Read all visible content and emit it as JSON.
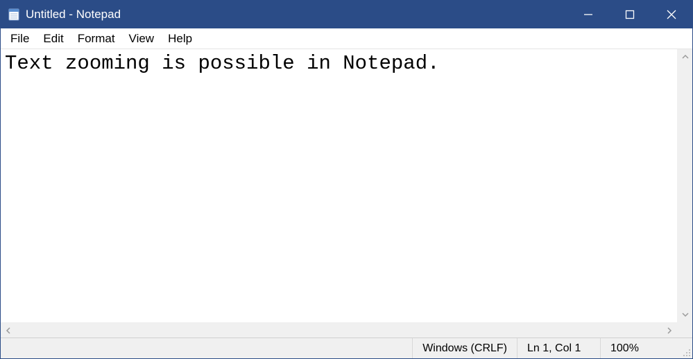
{
  "titlebar": {
    "title": "Untitled - Notepad"
  },
  "menu": {
    "items": [
      "File",
      "Edit",
      "Format",
      "View",
      "Help"
    ]
  },
  "editor": {
    "content": "Text zooming is possible in Notepad."
  },
  "statusbar": {
    "line_ending": "Windows (CRLF)",
    "cursor": "Ln 1, Col 1",
    "zoom": "100%"
  }
}
